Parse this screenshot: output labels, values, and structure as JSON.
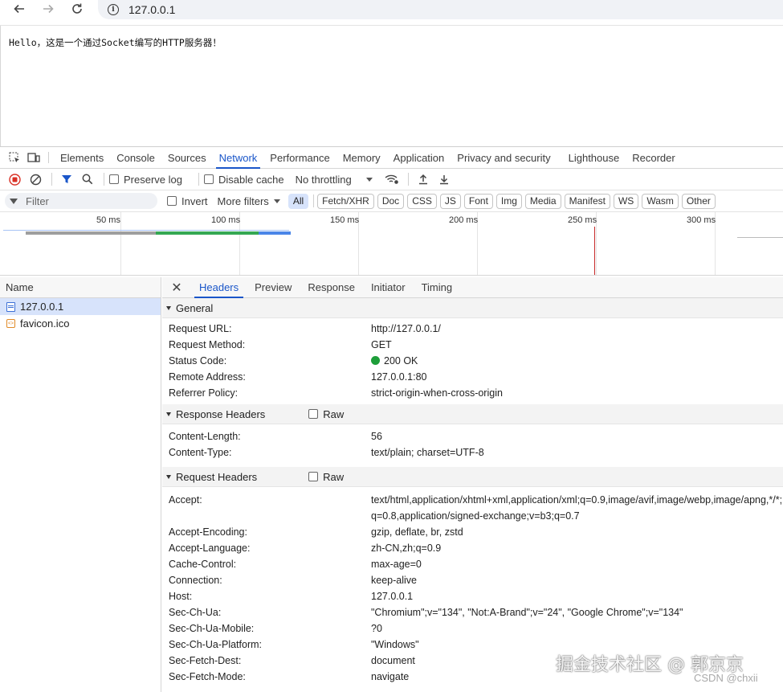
{
  "browser": {
    "url": "127.0.0.1",
    "back_icon": "arrow-left-icon",
    "forward_icon": "arrow-right-icon",
    "reload_icon": "reload-icon"
  },
  "page": {
    "text": "Hello，这是一个通过Socket编写的HTTP服务器！"
  },
  "devtools": {
    "tabs": [
      "Elements",
      "Console",
      "Sources",
      "Network",
      "Performance",
      "Memory",
      "Application",
      "Privacy and security",
      "Lighthouse",
      "Recorder"
    ],
    "active_tab": "Network",
    "toolbar": {
      "preserve_log": "Preserve log",
      "disable_cache": "Disable cache",
      "throttling": "No throttling"
    },
    "filter": {
      "placeholder": "Filter",
      "invert": "Invert",
      "more_filters": "More filters",
      "chips": [
        "All",
        "Fetch/XHR",
        "Doc",
        "CSS",
        "JS",
        "Font",
        "Img",
        "Media",
        "Manifest",
        "WS",
        "Wasm",
        "Other"
      ],
      "active_chip": "All"
    },
    "timeline": {
      "ticks": [
        "50 ms",
        "100 ms",
        "150 ms",
        "200 ms",
        "250 ms",
        "300 ms"
      ],
      "colors": {
        "queue": "#9e9e9e",
        "waiting": "#34a853",
        "download": "#4a86e8",
        "load_marker": "#c62828"
      }
    },
    "requests": {
      "header": "Name",
      "items": [
        {
          "name": "127.0.0.1",
          "type": "document",
          "selected": true
        },
        {
          "name": "favicon.ico",
          "type": "other",
          "selected": false
        }
      ]
    },
    "detail": {
      "tabs": [
        "Headers",
        "Preview",
        "Response",
        "Initiator",
        "Timing"
      ],
      "active_tab": "Headers",
      "general": {
        "title": "General",
        "rows": [
          {
            "key": "Request URL:",
            "value": "http://127.0.0.1/"
          },
          {
            "key": "Request Method:",
            "value": "GET"
          },
          {
            "key": "Status Code:",
            "value": "200 OK"
          },
          {
            "key": "Remote Address:",
            "value": "127.0.0.1:80"
          },
          {
            "key": "Referrer Policy:",
            "value": "strict-origin-when-cross-origin"
          }
        ]
      },
      "response_headers": {
        "title": "Response Headers",
        "raw": "Raw",
        "rows": [
          {
            "key": "Content-Length:",
            "value": "56"
          },
          {
            "key": "Content-Type:",
            "value": "text/plain; charset=UTF-8"
          }
        ]
      },
      "request_headers": {
        "title": "Request Headers",
        "raw": "Raw",
        "rows": [
          {
            "key": "Accept:",
            "value": "text/html,application/xhtml+xml,application/xml;q=0.9,image/avif,image/webp,image/apng,*/*;q=0.8,application/signed-exchange;v=b3;q=0.7"
          },
          {
            "key": "Accept-Encoding:",
            "value": "gzip, deflate, br, zstd"
          },
          {
            "key": "Accept-Language:",
            "value": "zh-CN,zh;q=0.9"
          },
          {
            "key": "Cache-Control:",
            "value": "max-age=0"
          },
          {
            "key": "Connection:",
            "value": "keep-alive"
          },
          {
            "key": "Host:",
            "value": "127.0.0.1"
          },
          {
            "key": "Sec-Ch-Ua:",
            "value": "\"Chromium\";v=\"134\", \"Not:A-Brand\";v=\"24\", \"Google Chrome\";v=\"134\""
          },
          {
            "key": "Sec-Ch-Ua-Mobile:",
            "value": "?0"
          },
          {
            "key": "Sec-Ch-Ua-Platform:",
            "value": "\"Windows\""
          },
          {
            "key": "Sec-Fetch-Dest:",
            "value": "document"
          },
          {
            "key": "Sec-Fetch-Mode:",
            "value": "navigate"
          }
        ]
      }
    }
  },
  "watermark": {
    "text": "掘金技术社区 @ 郭京京",
    "sub": "CSDN @chxii"
  },
  "colors": {
    "accent": "#1a56c9",
    "record_red": "#d93025",
    "status_ok": "#1e9e3a",
    "selected_bg": "#d7e3fb"
  }
}
